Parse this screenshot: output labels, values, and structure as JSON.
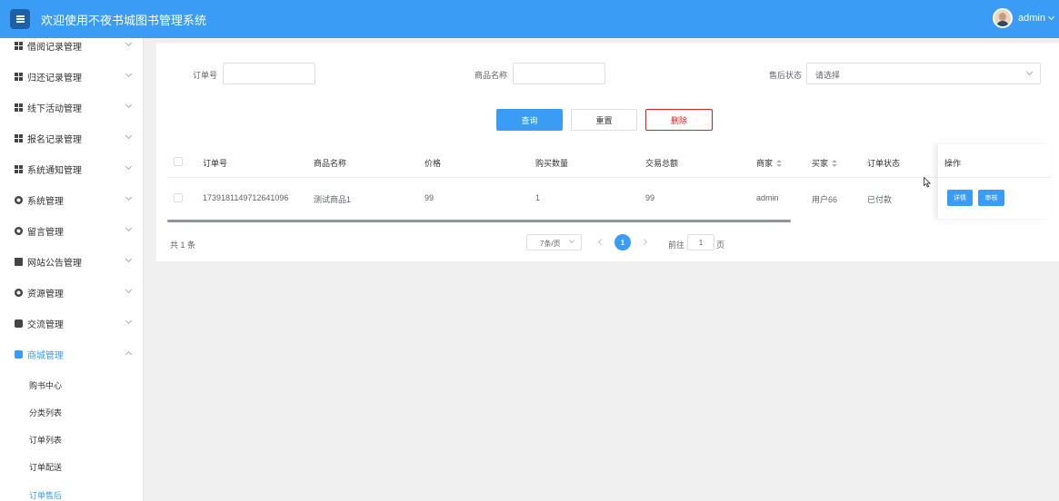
{
  "header": {
    "title": "欢迎使用不夜书城图书管理系统",
    "user": "admin"
  },
  "sidebar": {
    "items": [
      {
        "label": "借阅记录管理",
        "icon": "grid-icon"
      },
      {
        "label": "归还记录管理",
        "icon": "grid-icon"
      },
      {
        "label": "线下活动管理",
        "icon": "grid-icon"
      },
      {
        "label": "报名记录管理",
        "icon": "grid-icon"
      },
      {
        "label": "系统通知管理",
        "icon": "grid-icon"
      },
      {
        "label": "系统管理",
        "icon": "gear-icon"
      },
      {
        "label": "留言管理",
        "icon": "gear-icon"
      },
      {
        "label": "网站公告管理",
        "icon": "document-icon"
      },
      {
        "label": "资源管理",
        "icon": "gear-icon"
      },
      {
        "label": "交流管理",
        "icon": "chat-icon"
      },
      {
        "label": "商城管理",
        "icon": "shop-icon",
        "expanded": true
      }
    ],
    "subitems": [
      {
        "label": "购书中心"
      },
      {
        "label": "分类列表"
      },
      {
        "label": "订单列表"
      },
      {
        "label": "订单配送"
      },
      {
        "label": "订单售后",
        "active": true
      }
    ]
  },
  "search": {
    "order_no_label": "订单号",
    "order_no_value": "",
    "product_label": "商品名称",
    "product_value": "",
    "after_sale_label": "售后状态",
    "after_sale_placeholder": "请选择"
  },
  "actions": {
    "query": "查询",
    "reset": "重置",
    "delete": "删除"
  },
  "table": {
    "headers": [
      "订单号",
      "商品名称",
      "价格",
      "购买数量",
      "交易总额",
      "商家",
      "买家",
      "订单状态",
      "操作"
    ],
    "rows": [
      {
        "order_no": "1739181149712641096",
        "product": "测试商品1",
        "price": "99",
        "qty": "1",
        "total": "99",
        "seller": "admin",
        "buyer": "用户66",
        "status": "已付款",
        "op_detail": "详情",
        "op_review": "审核"
      }
    ]
  },
  "pagination": {
    "total": "共 1 条",
    "page_size": "7条/页",
    "current_page": "1",
    "goto_prefix": "前往",
    "goto_value": "1",
    "goto_suffix": "页"
  },
  "colors": {
    "primary": "#3a9cf5",
    "danger": "#e02020",
    "header": "#3a9cf5"
  }
}
